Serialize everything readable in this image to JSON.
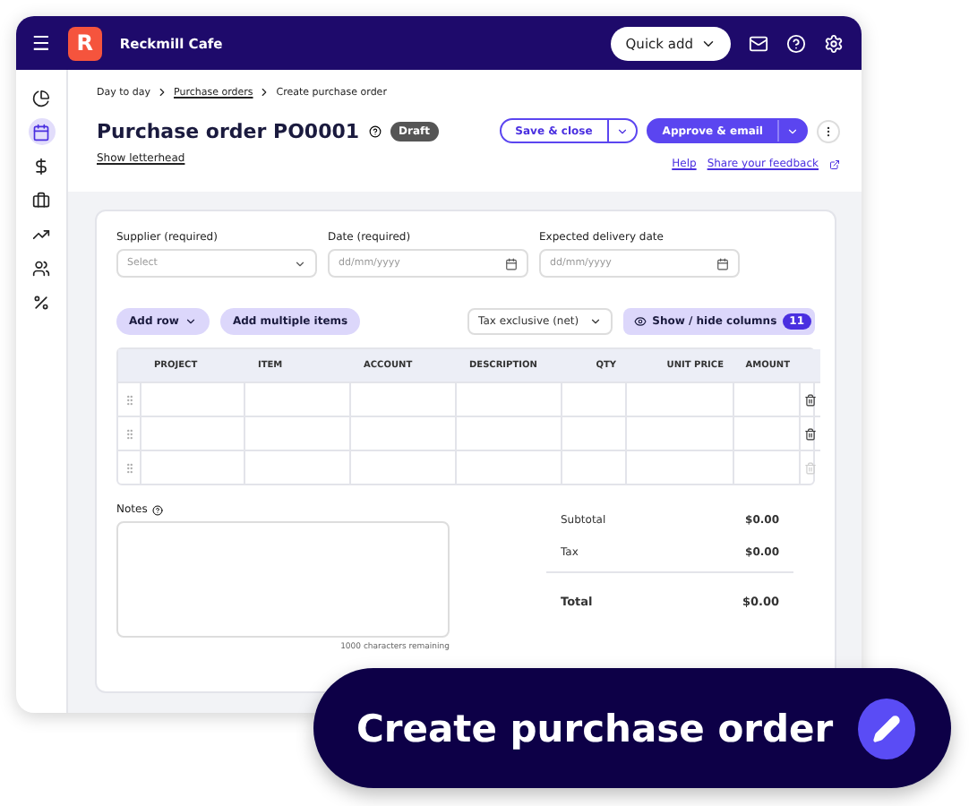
{
  "header": {
    "menu_icon": "☰",
    "logo_letter": "R",
    "business_name": "Reckmill Cafe",
    "quick_add": "Quick add"
  },
  "sidebar": {
    "items": [
      {
        "kind": "dashboard",
        "selected": false
      },
      {
        "kind": "calendar",
        "selected": true
      },
      {
        "kind": "dollar",
        "selected": false
      },
      {
        "kind": "briefcase",
        "selected": false
      },
      {
        "kind": "trend",
        "selected": false
      },
      {
        "kind": "people",
        "selected": false
      },
      {
        "kind": "percent",
        "selected": false
      }
    ]
  },
  "breadcrumbs": [
    {
      "label": "Day to day",
      "link": false
    },
    {
      "label": "Purchase orders",
      "link": true
    },
    {
      "label": "Create purchase order",
      "link": false
    }
  ],
  "title": "Purchase order PO0001",
  "status": "Draft",
  "show_letterhead": "Show letterhead",
  "actions": {
    "save": "Save & close",
    "approve": "Approve & email",
    "help": "Help",
    "feedback": "Share your feedback"
  },
  "fields": [
    {
      "label": "Supplier (required)",
      "placeholder": "Select",
      "kind": "select"
    },
    {
      "label": "Date (required)",
      "placeholder": "dd/mm/yyyy",
      "kind": "date"
    },
    {
      "label": "Expected delivery date",
      "placeholder": "dd/mm/yyyy",
      "kind": "date"
    }
  ],
  "toolbar": {
    "add_row": "Add row",
    "add_multiple": "Add multiple items",
    "tax": "Tax exclusive (net)",
    "columns": "Show / hide columns",
    "columns_count": "11"
  },
  "table": {
    "columns": [
      {
        "label": "PROJECT"
      },
      {
        "label": "ITEM"
      },
      {
        "label": "ACCOUNT"
      },
      {
        "label": "DESCRIPTION"
      },
      {
        "label": "QTY"
      },
      {
        "label": "UNIT PRICE"
      },
      {
        "label": "AMOUNT"
      }
    ],
    "rows": [
      {
        "disabled": false
      },
      {
        "disabled": false
      },
      {
        "disabled": true
      }
    ]
  },
  "notes": {
    "label": "Notes",
    "remaining": "1000 characters remaining"
  },
  "totals": [
    {
      "label": "Subtotal",
      "value": "$0.00",
      "kind": "line"
    },
    {
      "label": "Tax",
      "value": "$0.00",
      "kind": "line"
    },
    {
      "label": "Total",
      "value": "$0.00",
      "kind": "total"
    }
  ],
  "banner": {
    "text": "Create purchase order"
  }
}
